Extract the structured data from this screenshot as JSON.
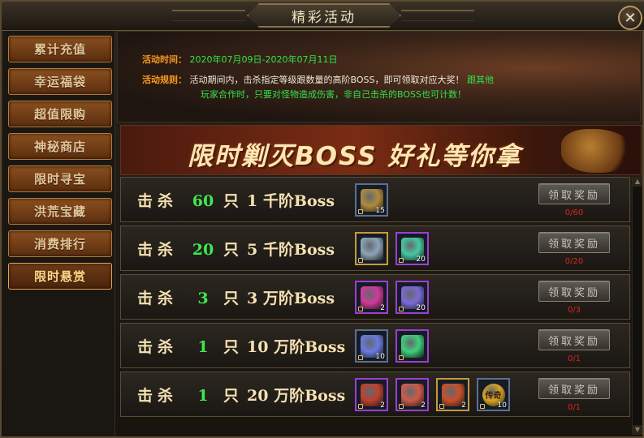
{
  "window": {
    "title": "精彩活动",
    "close_symbol": "✕"
  },
  "sidebar": {
    "items": [
      {
        "label": "累计充值",
        "active": false
      },
      {
        "label": "幸运福袋",
        "active": false
      },
      {
        "label": "超值限购",
        "active": false
      },
      {
        "label": "神秘商店",
        "active": false
      },
      {
        "label": "限时寻宝",
        "active": false
      },
      {
        "label": "洪荒宝藏",
        "active": false
      },
      {
        "label": "消费排行",
        "active": false
      },
      {
        "label": "限时悬赏",
        "active": true
      }
    ]
  },
  "info": {
    "time_label": "活动时间：",
    "time_value": "2020年07月09日-2020年07月11日",
    "rules_label": "活动规则：",
    "rules_white_1": "活动期间内，击杀指定等级跟数量的高阶BOSS，即可领取对应大奖！",
    "rules_green_1": "跟其他",
    "rules_green_2": "玩家合作时，只要对怪物造成伤害，非自己击杀的BOSS也可计数！"
  },
  "banner": {
    "text": "限时剿灭BOSS   好礼等你拿"
  },
  "rewards": [
    {
      "kill": "击杀",
      "count": "60",
      "unit": "只",
      "boss_num": "1",
      "boss_tier": "千阶Boss",
      "button": "领取奖励",
      "progress": "0/60",
      "items": [
        {
          "icon": "treasure-chest-icon",
          "qty": "15",
          "frame": "blue",
          "color": "#b08a3c"
        }
      ]
    },
    {
      "kill": "击杀",
      "count": "20",
      "unit": "只",
      "boss_num": "5",
      "boss_tier": "千阶Boss",
      "button": "领取奖励",
      "progress": "0/20",
      "items": [
        {
          "icon": "silver-medallion-icon",
          "qty": "",
          "frame": "gold",
          "color": "#8fa3b8"
        },
        {
          "icon": "green-crystal-icon",
          "qty": "20",
          "frame": "purple",
          "color": "#46c9a0"
        }
      ]
    },
    {
      "kill": "击杀",
      "count": "3",
      "unit": "只",
      "boss_num": "3",
      "boss_tier": "万阶Boss",
      "button": "领取奖励",
      "progress": "0/3",
      "items": [
        {
          "icon": "pink-gem-icon",
          "qty": "2",
          "frame": "purple",
          "color": "#d2389c"
        },
        {
          "icon": "purple-crystal-icon",
          "qty": "20",
          "frame": "purple",
          "color": "#7a6ad8"
        }
      ]
    },
    {
      "kill": "击杀",
      "count": "1",
      "unit": "只",
      "boss_num": "10",
      "boss_tier": "万阶Boss",
      "button": "领取奖励",
      "progress": "0/1",
      "items": [
        {
          "icon": "feather-icon",
          "qty": "10",
          "frame": "blue",
          "color": "#6a7ae0"
        },
        {
          "icon": "green-crystal-icon",
          "qty": "",
          "frame": "purple",
          "color": "#3fcf7a"
        }
      ]
    },
    {
      "kill": "击杀",
      "count": "1",
      "unit": "只",
      "boss_num": "20",
      "boss_tier": "万阶Boss",
      "button": "领取奖励",
      "progress": "0/1",
      "items": [
        {
          "icon": "red-staff-icon",
          "qty": "2",
          "frame": "purple",
          "color": "#c0402e"
        },
        {
          "icon": "red-crystal-icon",
          "qty": "2",
          "frame": "purple",
          "color": "#d05a4a"
        },
        {
          "icon": "fire-orb-icon",
          "qty": "2",
          "frame": "gold",
          "color": "#c8502a"
        },
        {
          "icon": "legend-coin-icon",
          "qty": "10",
          "frame": "blue",
          "color": "#d9a323",
          "text": "传奇"
        }
      ]
    }
  ],
  "colors": {
    "accent_orange": "#ff9a1e",
    "accent_green": "#33e24a",
    "progress_red": "#d9261e"
  }
}
